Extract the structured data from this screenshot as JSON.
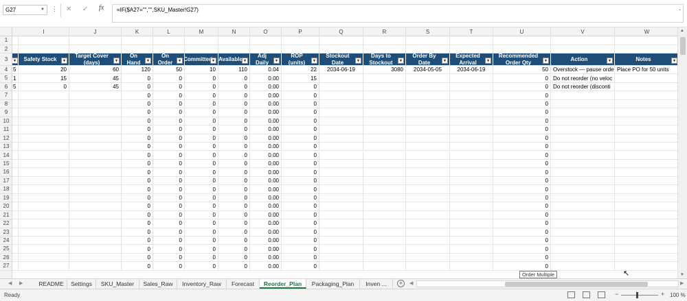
{
  "formula_bar": {
    "name_box": "G27",
    "fx": "fx",
    "formula": "=IF($A27=\"\",\"\",SKU_Master!G27)"
  },
  "columns": [
    "I",
    "J",
    "K",
    "L",
    "M",
    "N",
    "O",
    "P",
    "Q",
    "R",
    "S",
    "T",
    "U",
    "V",
    "W"
  ],
  "headers": [
    "Safety Stock",
    "Target Cover (days)",
    "On Hand",
    "On Order",
    "Committed",
    "Available",
    "Adj Daily",
    "ROP (units)",
    "Stockout Date",
    "Days to Stockout",
    "Order By Date",
    "Expected Arrival",
    "Recommended Order Qty",
    "Action",
    "Notes"
  ],
  "rows": [
    {
      "num": "1",
      "cells": []
    },
    {
      "num": "2",
      "cells": []
    },
    {
      "num": "4",
      "lead": "5",
      "cells": [
        "20",
        "60",
        "120",
        "50",
        "10",
        "110",
        "0.04",
        "22",
        "2034-06-19",
        "3080",
        "2034-05-05",
        "2034-06-19",
        "50",
        "Overstock — pause orde",
        "Place PO for 50 units"
      ]
    },
    {
      "num": "5",
      "lead": "1",
      "cells": [
        "15",
        "45",
        "0",
        "0",
        "0",
        "0",
        "0.00",
        "15",
        "",
        "",
        "",
        "",
        "0",
        "Do not reorder (no veloc",
        ""
      ]
    },
    {
      "num": "6",
      "lead": "5",
      "cells": [
        "0",
        "45",
        "0",
        "0",
        "0",
        "0",
        "0.00",
        "0",
        "",
        "",
        "",
        "",
        "0",
        "Do not reorder (disconti",
        ""
      ]
    },
    {
      "num": "7",
      "cells": [
        "",
        "",
        "0",
        "0",
        "0",
        "0",
        "0.00",
        "0",
        "",
        "",
        "",
        "",
        "0",
        "",
        ""
      ]
    },
    {
      "num": "8",
      "cells": [
        "",
        "",
        "0",
        "0",
        "0",
        "0",
        "0.00",
        "0",
        "",
        "",
        "",
        "",
        "0",
        "",
        ""
      ]
    },
    {
      "num": "9",
      "cells": [
        "",
        "",
        "0",
        "0",
        "0",
        "0",
        "0.00",
        "0",
        "",
        "",
        "",
        "",
        "0",
        "",
        ""
      ]
    },
    {
      "num": "10",
      "cells": [
        "",
        "",
        "0",
        "0",
        "0",
        "0",
        "0.00",
        "0",
        "",
        "",
        "",
        "",
        "0",
        "",
        ""
      ]
    },
    {
      "num": "11",
      "cells": [
        "",
        "",
        "0",
        "0",
        "0",
        "0",
        "0.00",
        "0",
        "",
        "",
        "",
        "",
        "0",
        "",
        ""
      ]
    },
    {
      "num": "12",
      "cells": [
        "",
        "",
        "0",
        "0",
        "0",
        "0",
        "0.00",
        "0",
        "",
        "",
        "",
        "",
        "0",
        "",
        ""
      ]
    },
    {
      "num": "13",
      "cells": [
        "",
        "",
        "0",
        "0",
        "0",
        "0",
        "0.00",
        "0",
        "",
        "",
        "",
        "",
        "0",
        "",
        ""
      ]
    },
    {
      "num": "14",
      "cells": [
        "",
        "",
        "0",
        "0",
        "0",
        "0",
        "0.00",
        "0",
        "",
        "",
        "",
        "",
        "0",
        "",
        ""
      ]
    },
    {
      "num": "15",
      "cells": [
        "",
        "",
        "0",
        "0",
        "0",
        "0",
        "0.00",
        "0",
        "",
        "",
        "",
        "",
        "0",
        "",
        ""
      ]
    },
    {
      "num": "16",
      "cells": [
        "",
        "",
        "0",
        "0",
        "0",
        "0",
        "0.00",
        "0",
        "",
        "",
        "",
        "",
        "0",
        "",
        ""
      ]
    },
    {
      "num": "17",
      "cells": [
        "",
        "",
        "0",
        "0",
        "0",
        "0",
        "0.00",
        "0",
        "",
        "",
        "",
        "",
        "0",
        "",
        ""
      ]
    },
    {
      "num": "18",
      "cells": [
        "",
        "",
        "0",
        "0",
        "0",
        "0",
        "0.00",
        "0",
        "",
        "",
        "",
        "",
        "0",
        "",
        ""
      ]
    },
    {
      "num": "19",
      "cells": [
        "",
        "",
        "0",
        "0",
        "0",
        "0",
        "0.00",
        "0",
        "",
        "",
        "",
        "",
        "0",
        "",
        ""
      ]
    },
    {
      "num": "20",
      "cells": [
        "",
        "",
        "0",
        "0",
        "0",
        "0",
        "0.00",
        "0",
        "",
        "",
        "",
        "",
        "0",
        "",
        ""
      ]
    },
    {
      "num": "21",
      "cells": [
        "",
        "",
        "0",
        "0",
        "0",
        "0",
        "0.00",
        "0",
        "",
        "",
        "",
        "",
        "0",
        "",
        ""
      ]
    },
    {
      "num": "22",
      "cells": [
        "",
        "",
        "0",
        "0",
        "0",
        "0",
        "0.00",
        "0",
        "",
        "",
        "",
        "",
        "0",
        "",
        ""
      ]
    },
    {
      "num": "23",
      "cells": [
        "",
        "",
        "0",
        "0",
        "0",
        "0",
        "0.00",
        "0",
        "",
        "",
        "",
        "",
        "0",
        "",
        ""
      ]
    },
    {
      "num": "24",
      "cells": [
        "",
        "",
        "0",
        "0",
        "0",
        "0",
        "0.00",
        "0",
        "",
        "",
        "",
        "",
        "0",
        "",
        ""
      ]
    },
    {
      "num": "25",
      "cells": [
        "",
        "",
        "0",
        "0",
        "0",
        "0",
        "0.00",
        "0",
        "",
        "",
        "",
        "",
        "0",
        "",
        ""
      ]
    },
    {
      "num": "26",
      "cells": [
        "",
        "",
        "0",
        "0",
        "0",
        "0",
        "0.00",
        "0",
        "",
        "",
        "",
        "",
        "0",
        "",
        ""
      ]
    },
    {
      "num": "27",
      "cells": [
        "",
        "",
        "0",
        "0",
        "0",
        "0",
        "0.00",
        "0",
        "",
        "",
        "",
        "",
        "0",
        "",
        ""
      ]
    }
  ],
  "header_row_num": "3",
  "tabs": [
    "README",
    "Settings",
    "SKU_Master",
    "Sales_Raw",
    "Inventory_Raw",
    "Forecast",
    "Reorder_Plan",
    "Packaging_Plan",
    "Inven ..."
  ],
  "active_tab": "Reorder_Plan",
  "tooltip": "Order Multiple",
  "status": {
    "ready": "Ready",
    "zoom": "100 %"
  },
  "colors": {
    "header_bg": "#1f4e79",
    "active_tab": "#217346"
  }
}
